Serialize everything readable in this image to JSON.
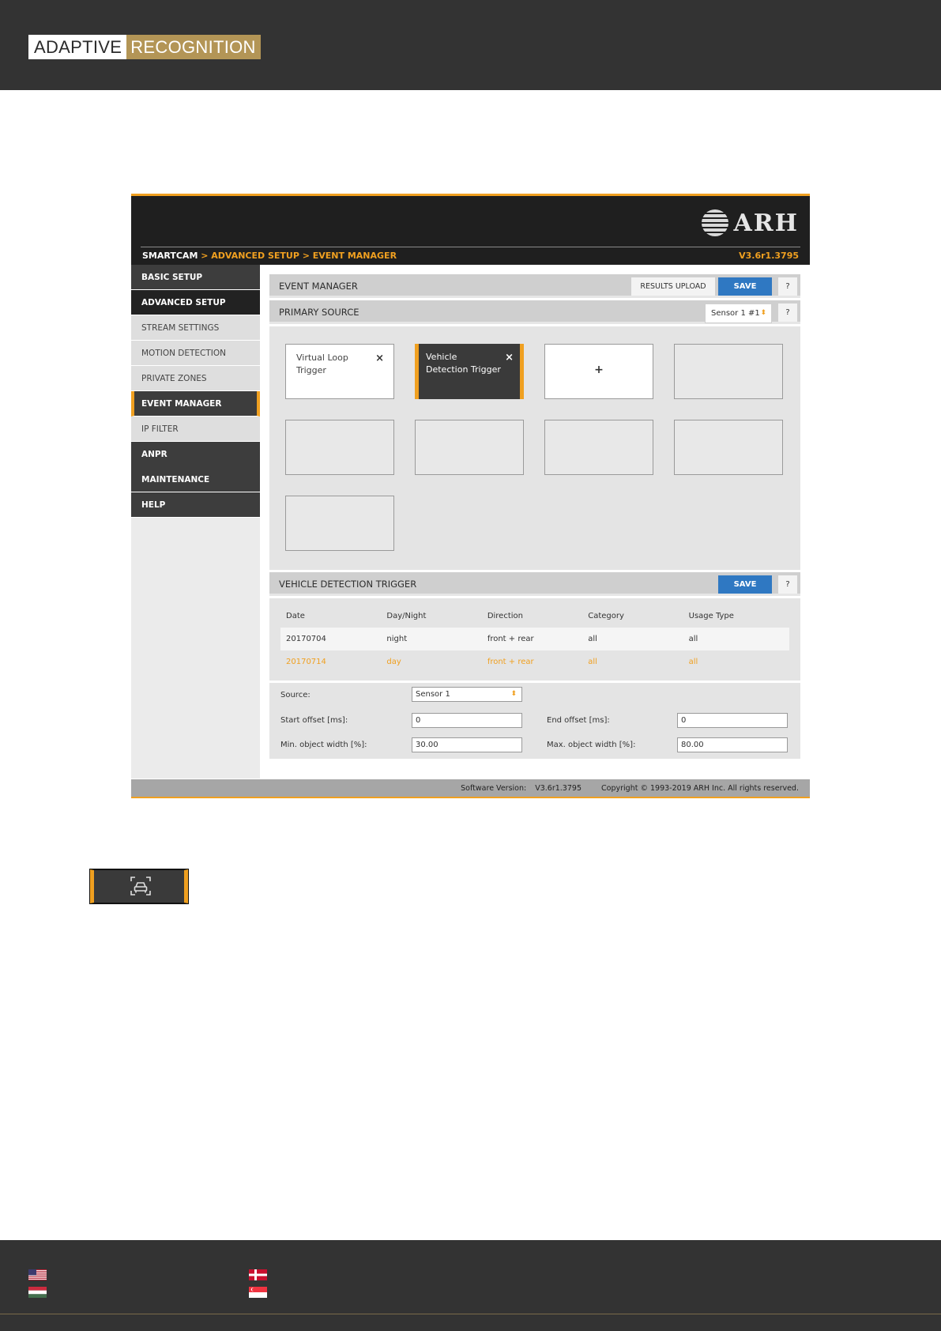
{
  "brand": {
    "left": "ADAPTIVE",
    "right": "RECOGNITION"
  },
  "app": {
    "logo_text": "ARH",
    "breadcrumb": {
      "root": "SMARTCAM",
      "path": " > ADVANCED SETUP > EVENT MANAGER"
    },
    "version_top": "V3.6r1.3795",
    "sidebar": [
      {
        "label": "BASIC SETUP",
        "style": "dark"
      },
      {
        "label": "ADVANCED SETUP",
        "style": "darker"
      },
      {
        "label": "STREAM SETTINGS",
        "style": "light"
      },
      {
        "label": "MOTION DETECTION",
        "style": "light"
      },
      {
        "label": "PRIVATE ZONES",
        "style": "light"
      },
      {
        "label": "EVENT MANAGER",
        "style": "active"
      },
      {
        "label": "IP FILTER",
        "style": "light"
      },
      {
        "label": "ANPR",
        "style": "dark"
      },
      {
        "label": "MAINTENANCE",
        "style": "dark"
      },
      {
        "label": "HELP",
        "style": "dark"
      }
    ],
    "event_manager": {
      "title": "EVENT MANAGER",
      "results_upload": "RESULTS UPLOAD",
      "save": "SAVE",
      "help": "?"
    },
    "primary_source": {
      "title": "PRIMARY SOURCE",
      "selected": "Sensor 1 #1",
      "help": "?"
    },
    "triggers": [
      {
        "label": "Virtual Loop Trigger",
        "close": "×"
      },
      {
        "label": "Vehicle Detection Trigger",
        "close": "×"
      },
      {
        "add": "+"
      }
    ],
    "vehicle_trigger": {
      "title": "VEHICLE DETECTION TRIGGER",
      "save": "SAVE",
      "help": "?",
      "columns": [
        "Date",
        "Day/Night",
        "Direction",
        "Category",
        "Usage Type"
      ],
      "rows": [
        [
          "20170704",
          "night",
          "front + rear",
          "all",
          "all"
        ],
        [
          "20170714",
          "day",
          "front + rear",
          "all",
          "all"
        ]
      ]
    },
    "form": {
      "source_label": "Source:",
      "source_value": "Sensor 1",
      "start_offset_label": "Start offset [ms]:",
      "start_offset_value": "0",
      "end_offset_label": "End offset [ms]:",
      "end_offset_value": "0",
      "min_width_label": "Min. object width [%]:",
      "min_width_value": "30.00",
      "max_width_label": "Max. object width [%]:",
      "max_width_value": "80.00"
    },
    "footer": {
      "software_version_label": "Software Version:",
      "software_version": "V3.6r1.3795",
      "copyright": "Copyright © 1993-2019 ARH Inc. All rights reserved."
    }
  },
  "icons": [
    "vehicle-detection-icon",
    "us-flag-icon",
    "hungary-flag-icon",
    "denmark-flag-icon",
    "singapore-flag-icon"
  ],
  "colors": {
    "accent": "#f0a020",
    "save_blue": "#2f78c2",
    "brand_gold": "#b39556",
    "header_dark": "#333333"
  }
}
